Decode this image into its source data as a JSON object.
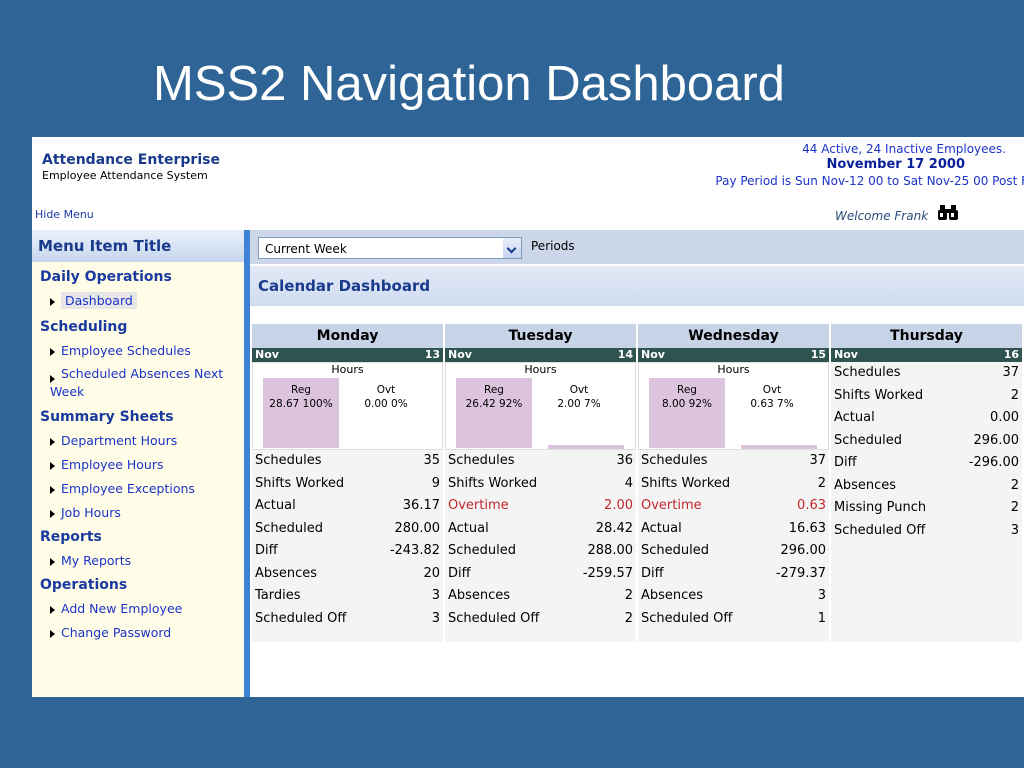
{
  "slide_title": "MSS2 Navigation Dashboard",
  "app": {
    "name": "Attendance Enterprise",
    "subtitle": "Employee Attendance System"
  },
  "header": {
    "employees": "44 Active, 24 Inactive Employees.",
    "date": "November 17 2000",
    "pay_period": "Pay Period is Sun Nov-12 00 to Sat Nov-25 00 Post F",
    "hide_menu": "Hide Menu",
    "welcome": "Welcome Frank"
  },
  "menu": {
    "title": "Menu Item Title",
    "sections": [
      {
        "title": "Daily Operations",
        "items": [
          "Dashboard"
        ]
      },
      {
        "title": "Scheduling",
        "items": [
          "Employee Schedules",
          "Scheduled Absences Next Week"
        ]
      },
      {
        "title": "Summary Sheets",
        "items": [
          "Department Hours",
          "Employee Hours",
          "Employee Exceptions",
          "Job Hours"
        ]
      },
      {
        "title": "Reports",
        "items": [
          "My Reports"
        ]
      },
      {
        "title": "Operations",
        "items": [
          "Add New Employee",
          "Change Password"
        ]
      }
    ],
    "selected": "Dashboard"
  },
  "toolbar": {
    "period_select": "Current Week",
    "periods_label": "Periods"
  },
  "dashboard": {
    "title": "Calendar Dashboard",
    "hours_label": "Hours",
    "reg_label": "Reg",
    "ovt_label": "Ovt",
    "days": [
      {
        "name": "Monday",
        "month": "Nov",
        "date": "13",
        "reg": "28.67 100%",
        "ovt": "0.00 0%",
        "stats": [
          {
            "label": "Schedules",
            "value": "35"
          },
          {
            "label": "Shifts Worked",
            "value": "9"
          },
          {
            "label": "Actual",
            "value": "36.17"
          },
          {
            "label": "Scheduled",
            "value": "280.00"
          },
          {
            "label": "Diff",
            "value": "-243.82"
          },
          {
            "label": "Absences",
            "value": "20"
          },
          {
            "label": "Tardies",
            "value": "3"
          },
          {
            "label": "Scheduled Off",
            "value": "3"
          }
        ]
      },
      {
        "name": "Tuesday",
        "month": "Nov",
        "date": "14",
        "reg": "26.42 92%",
        "ovt": "2.00 7%",
        "stats": [
          {
            "label": "Schedules",
            "value": "36"
          },
          {
            "label": "Shifts Worked",
            "value": "4"
          },
          {
            "label": "Overtime",
            "value": "2.00",
            "alert": true
          },
          {
            "label": "Actual",
            "value": "28.42"
          },
          {
            "label": "Scheduled",
            "value": "288.00"
          },
          {
            "label": "Diff",
            "value": "-259.57"
          },
          {
            "label": "Absences",
            "value": "2"
          },
          {
            "label": "Scheduled Off",
            "value": "2"
          }
        ]
      },
      {
        "name": "Wednesday",
        "month": "Nov",
        "date": "15",
        "reg": "8.00 92%",
        "ovt": "0.63 7%",
        "stats": [
          {
            "label": "Schedules",
            "value": "37"
          },
          {
            "label": "Shifts Worked",
            "value": "2"
          },
          {
            "label": "Overtime",
            "value": "0.63",
            "alert": true
          },
          {
            "label": "Actual",
            "value": "16.63"
          },
          {
            "label": "Scheduled",
            "value": "296.00"
          },
          {
            "label": "Diff",
            "value": "-279.37"
          },
          {
            "label": "Absences",
            "value": "3"
          },
          {
            "label": "Scheduled Off",
            "value": "1"
          }
        ]
      },
      {
        "name": "Thursday",
        "month": "Nov",
        "date": "16",
        "stats": [
          {
            "label": "Schedules",
            "value": "37"
          },
          {
            "label": "Shifts Worked",
            "value": "2"
          },
          {
            "label": "Actual",
            "value": "0.00"
          },
          {
            "label": "Scheduled",
            "value": "296.00"
          },
          {
            "label": "Diff",
            "value": "-296.00"
          },
          {
            "label": "Absences",
            "value": "2"
          },
          {
            "label": "Missing Punch",
            "value": "2"
          },
          {
            "label": "Scheduled Off",
            "value": "3"
          }
        ]
      }
    ]
  }
}
